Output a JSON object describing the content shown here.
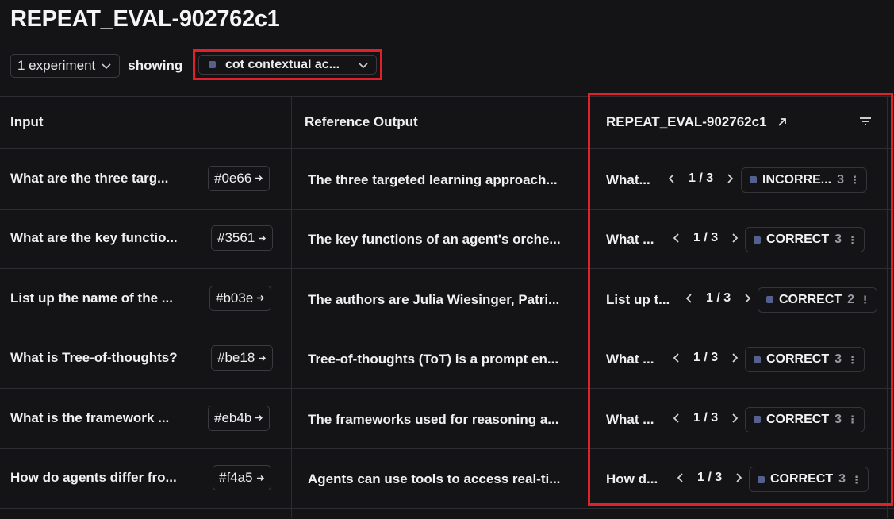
{
  "title": "REPEAT_EVAL-902762c1",
  "toolbar": {
    "experiment_select": "1 experiment",
    "showing_label": "showing",
    "metric_select": "cot contextual ac..."
  },
  "table": {
    "headers": {
      "input": "Input",
      "reference_output": "Reference Output",
      "experiment": "REPEAT_EVAL-902762c1"
    },
    "rows": [
      {
        "input": "What are the three targ...",
        "id": "#0e66",
        "reference": "The three targeted learning approach...",
        "exp_input": "What...",
        "pager": "1 / 3",
        "feedback": "INCORRE...",
        "count": "3"
      },
      {
        "input": "What are the key functio...",
        "id": "#3561",
        "reference": "The key functions of an agent's orche...",
        "exp_input": "What ...",
        "pager": "1 / 3",
        "feedback": "CORRECT",
        "count": "3"
      },
      {
        "input": "List up the name of the ...",
        "id": "#b03e",
        "reference": "The authors are Julia Wiesinger, Patri...",
        "exp_input": "List up t...",
        "pager": "1 / 3",
        "feedback": "CORRECT",
        "count": "2"
      },
      {
        "input": "What is Tree-of-thoughts?",
        "id": "#be18",
        "reference": "Tree-of-thoughts (ToT) is a prompt en...",
        "exp_input": "What ...",
        "pager": "1 / 3",
        "feedback": "CORRECT",
        "count": "3"
      },
      {
        "input": "What is the framework ...",
        "id": "#eb4b",
        "reference": "The frameworks used for reasoning a...",
        "exp_input": "What ...",
        "pager": "1 / 3",
        "feedback": "CORRECT",
        "count": "3"
      },
      {
        "input": "How do agents differ fro...",
        "id": "#f4a5",
        "reference": "Agents can use tools to access real-ti...",
        "exp_input": "How d...",
        "pager": "1 / 3",
        "feedback": "CORRECT",
        "count": "3"
      }
    ]
  },
  "colors": {
    "background": "#141416",
    "border": "#2c2c31",
    "highlight": "#e0202a",
    "metric_swatch": "#55608f"
  },
  "icons": {
    "arrow": "arrow-right-icon",
    "external": "external-link-icon",
    "filter": "filter-icon",
    "chevron": "chevron-down-icon"
  }
}
